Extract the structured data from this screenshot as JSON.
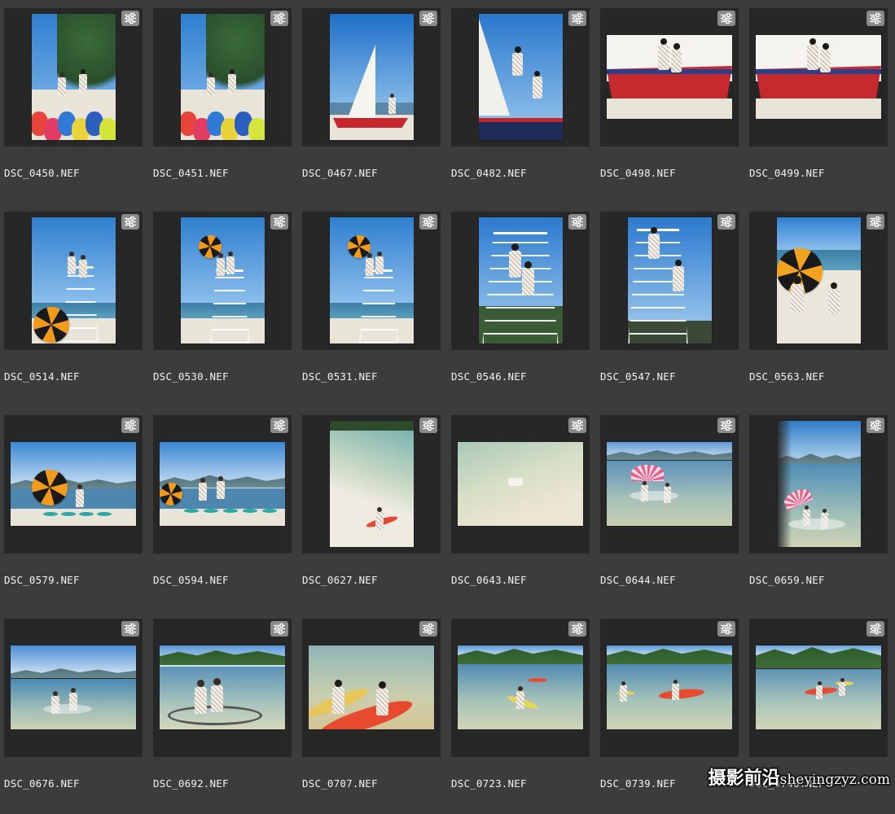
{
  "adjust_icon": "sliders-icon",
  "watermark": {
    "cjk": "摄影前沿",
    "domain": "sheyingzyz.com"
  },
  "files": [
    {
      "name": "DSC_0450.NEF",
      "orientation": "portrait",
      "scene": "tree-kayaks"
    },
    {
      "name": "DSC_0451.NEF",
      "orientation": "portrait",
      "scene": "tree-kayaks"
    },
    {
      "name": "DSC_0467.NEF",
      "orientation": "portrait",
      "scene": "sailboat-far"
    },
    {
      "name": "DSC_0482.NEF",
      "orientation": "portrait",
      "scene": "sailboat-near"
    },
    {
      "name": "DSC_0498.NEF",
      "orientation": "landscape",
      "scene": "boat-sit"
    },
    {
      "name": "DSC_0499.NEF",
      "orientation": "landscape",
      "scene": "boat-sit"
    },
    {
      "name": "DSC_0514.NEF",
      "orientation": "portrait",
      "scene": "tower-umbrella-low"
    },
    {
      "name": "DSC_0530.NEF",
      "orientation": "portrait",
      "scene": "tower-umbrella-high"
    },
    {
      "name": "DSC_0531.NEF",
      "orientation": "portrait",
      "scene": "tower-umbrella-high"
    },
    {
      "name": "DSC_0546.NEF",
      "orientation": "portrait",
      "scene": "tower-close"
    },
    {
      "name": "DSC_0547.NEF",
      "orientation": "portrait",
      "scene": "tower-close2"
    },
    {
      "name": "DSC_0563.NEF",
      "orientation": "portrait",
      "scene": "umbrella-sit"
    },
    {
      "name": "DSC_0579.NEF",
      "orientation": "landscape",
      "scene": "beach-umbrella-dance"
    },
    {
      "name": "DSC_0594.NEF",
      "orientation": "landscape",
      "scene": "beach-umbrella-wide"
    },
    {
      "name": "DSC_0627.NEF",
      "orientation": "portrait",
      "scene": "aerial-shore"
    },
    {
      "name": "DSC_0643.NEF",
      "orientation": "landscape",
      "scene": "aerial-shallow"
    },
    {
      "name": "DSC_0644.NEF",
      "orientation": "landscape",
      "scene": "sea-pink-umbrella"
    },
    {
      "name": "DSC_0659.NEF",
      "orientation": "portrait",
      "scene": "sea-pink-umbrella-port"
    },
    {
      "name": "DSC_0676.NEF",
      "orientation": "landscape",
      "scene": "sea-sit"
    },
    {
      "name": "DSC_0692.NEF",
      "orientation": "landscape",
      "scene": "clear-kayak"
    },
    {
      "name": "DSC_0707.NEF",
      "orientation": "landscape",
      "scene": "kayaks-close"
    },
    {
      "name": "DSC_0723.NEF",
      "orientation": "landscape",
      "scene": "kayak-paddle"
    },
    {
      "name": "DSC_0739.NEF",
      "orientation": "landscape",
      "scene": "kayaks-two"
    },
    {
      "name": "DSC_0740.NEF",
      "orientation": "landscape",
      "scene": "kayaks-far"
    }
  ],
  "colors": {
    "background": "#3c3c3c",
    "tile": "#272727",
    "adjust_badge": "#8a8a8a",
    "filename": "#f2f2f2"
  }
}
